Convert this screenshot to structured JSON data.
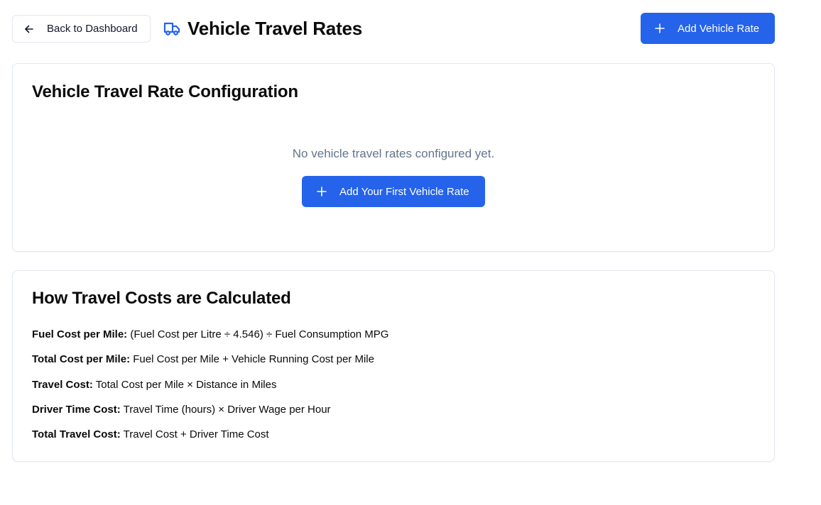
{
  "header": {
    "back_label": "Back to Dashboard",
    "title": "Vehicle Travel Rates",
    "add_button_label": "Add Vehicle Rate"
  },
  "config_card": {
    "title": "Vehicle Travel Rate Configuration",
    "empty_text": "No vehicle travel rates configured yet.",
    "first_rate_button_label": "Add Your First Vehicle Rate"
  },
  "calc_card": {
    "title": "How Travel Costs are Calculated",
    "formulas": [
      {
        "label": "Fuel Cost per Mile:",
        "text": " (Fuel Cost per Litre ÷ 4.546) ÷ Fuel Consumption MPG"
      },
      {
        "label": "Total Cost per Mile:",
        "text": " Fuel Cost per Mile + Vehicle Running Cost per Mile"
      },
      {
        "label": "Travel Cost:",
        "text": " Total Cost per Mile × Distance in Miles"
      },
      {
        "label": "Driver Time Cost:",
        "text": " Travel Time (hours) × Driver Wage per Hour"
      },
      {
        "label": "Total Travel Cost:",
        "text": " Travel Cost + Driver Time Cost"
      }
    ]
  },
  "icons": {
    "back": "arrow-left-icon",
    "title": "truck-icon",
    "add": "plus-icon"
  },
  "colors": {
    "accent": "#2563eb",
    "muted_text": "#64748b",
    "border": "#e2e8f0"
  }
}
